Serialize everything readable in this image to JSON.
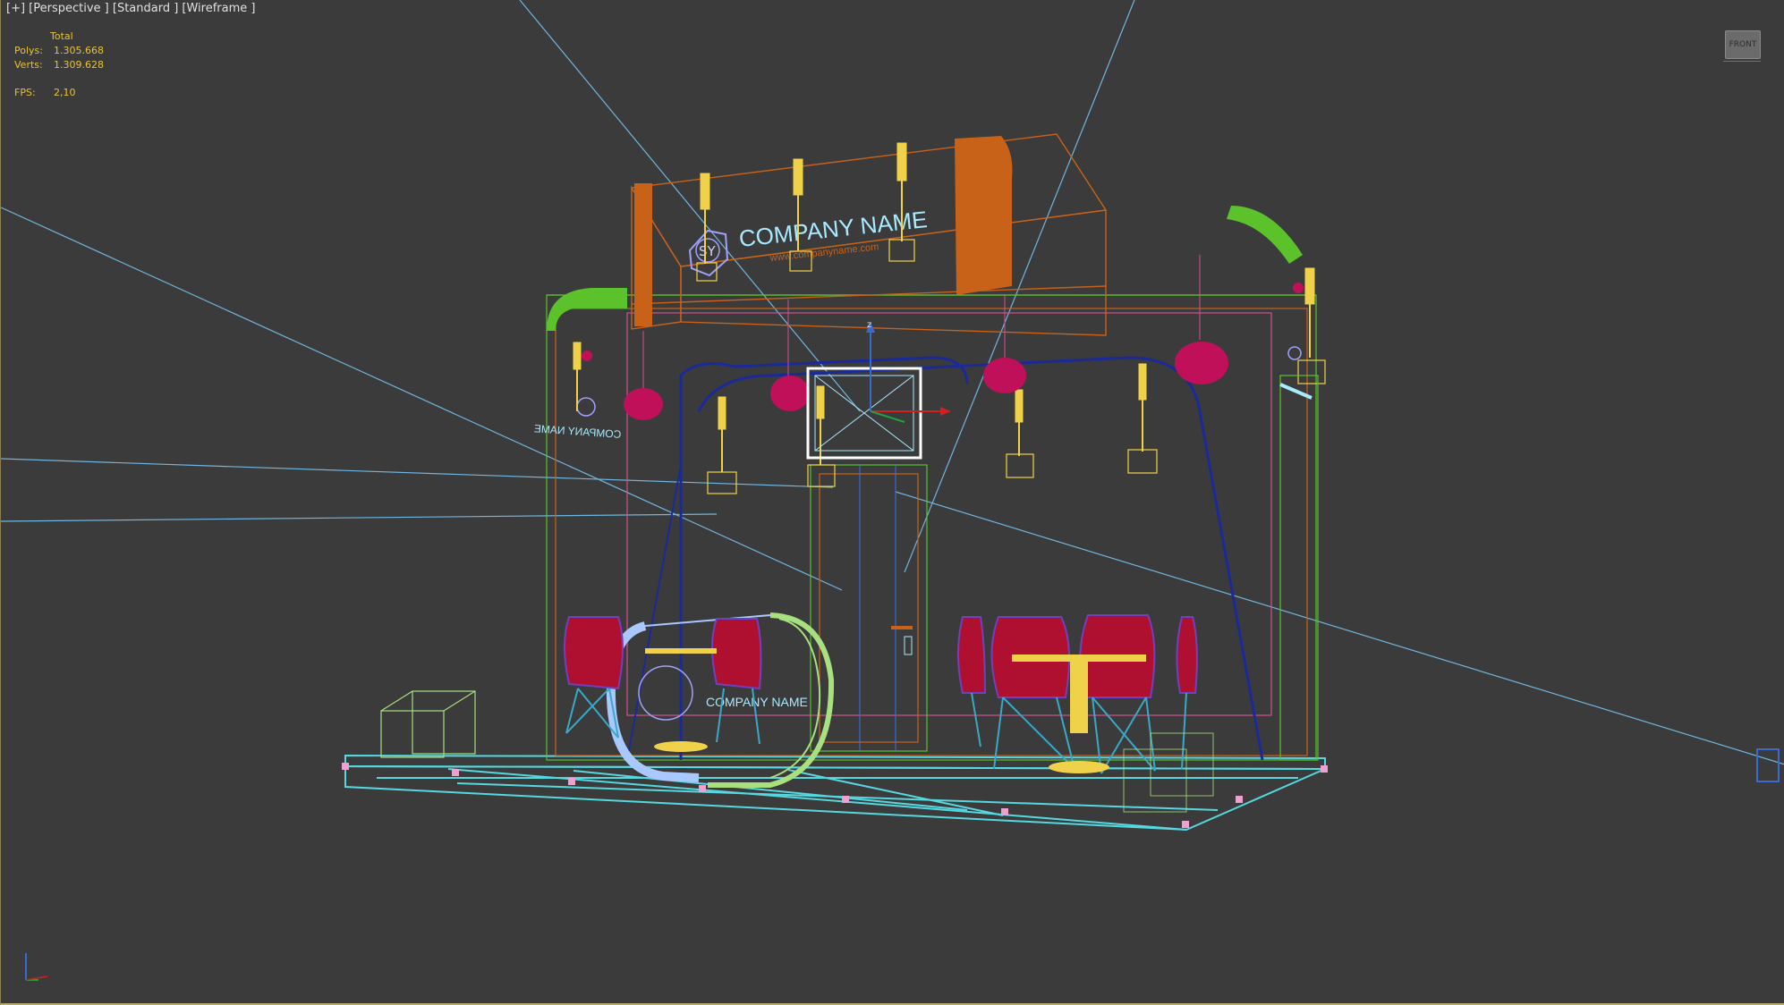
{
  "viewport": {
    "label": "[+] [Perspective ] [Standard ] [Wireframe ]",
    "stats": {
      "header": "Total",
      "polys_label": "Polys:",
      "polys_value": "1.305.668",
      "verts_label": "Verts:",
      "verts_value": "1.309.628",
      "fps_label": "FPS:",
      "fps_value": "2,10"
    },
    "viewcube_label": "FRONT"
  },
  "scene": {
    "company_name_top": "COMPANY NAME",
    "website": "www.companyname.com",
    "logo_text": "SY",
    "company_name_left_mirrored": "COMPANY NAME",
    "company_name_front": "COMPANY NAME",
    "gizmo_axis_label": "z"
  },
  "colors": {
    "background": "#3b3b3b",
    "stats_text": "#e8c23a",
    "orange": "#c86218",
    "green": "#5cc22b",
    "chair_red": "#b01030",
    "lamp_magenta": "#c0105a",
    "floor_cyan": "#55d8e0",
    "light_blue": "#6fb6e0",
    "yellow": "#f0d24a",
    "navy": "#1a2a9a"
  }
}
